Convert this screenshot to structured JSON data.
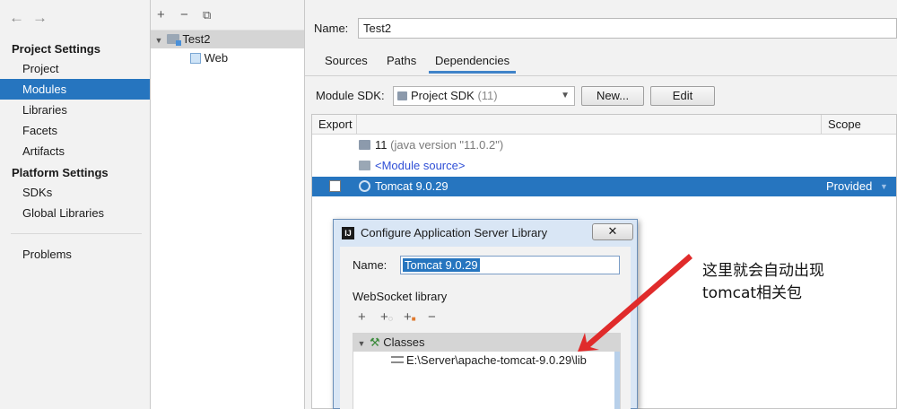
{
  "left": {
    "sections": [
      {
        "title": "Project Settings",
        "items": [
          "Project",
          "Modules",
          "Libraries",
          "Facets",
          "Artifacts"
        ]
      },
      {
        "title": "Platform Settings",
        "items": [
          "SDKs",
          "Global Libraries"
        ]
      }
    ],
    "bottom_item": "Problems",
    "selected": "Modules"
  },
  "middle": {
    "tree": [
      {
        "label": "Test2",
        "icon": "module-folder-icon"
      },
      {
        "label": "Web",
        "icon": "web-facet-icon"
      }
    ]
  },
  "main": {
    "name_label": "Name:",
    "name_value": "Test2",
    "tabs": [
      "Sources",
      "Paths",
      "Dependencies"
    ],
    "active_tab": "Dependencies",
    "sdk_label": "Module SDK:",
    "sdk_value": "Project SDK",
    "sdk_value_suffix": "(11)",
    "new_button": "New...",
    "edit_button": "Edit",
    "columns": [
      "Export",
      "Scope"
    ],
    "rows": [
      {
        "label": "11",
        "detail": "(java version \"11.0.2\")"
      },
      {
        "label": "<Module source>"
      },
      {
        "label": "Tomcat 9.0.29",
        "scope": "Provided"
      }
    ]
  },
  "dialog": {
    "title": "Configure Application Server Library",
    "close": "✕",
    "name_label": "Name:",
    "name_value": "Tomcat 9.0.29",
    "websocket_label": "WebSocket library",
    "classes_label": "Classes",
    "lib_path": "E:\\Server\\apache-tomcat-9.0.29\\lib"
  },
  "annotation": {
    "line1": "这里就会自动出现",
    "line2": "tomcat相关包",
    "color": "#e02b2b"
  }
}
